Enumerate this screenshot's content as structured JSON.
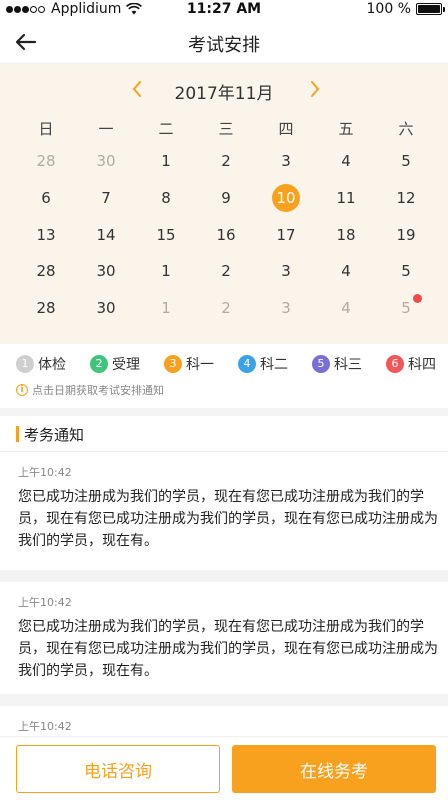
{
  "status_bar": {
    "carrier": "Applidium",
    "time": "11:27 AM",
    "battery": "100 %"
  },
  "nav": {
    "title": "考试安排"
  },
  "calendar": {
    "month": "2017年11月",
    "weekdays": [
      "日",
      "一",
      "二",
      "三",
      "四",
      "五",
      "六"
    ],
    "rows": [
      [
        {
          "d": "28",
          "muted": true
        },
        {
          "d": "30",
          "muted": true
        },
        {
          "d": "1"
        },
        {
          "d": "2"
        },
        {
          "d": "3"
        },
        {
          "d": "4"
        },
        {
          "d": "5"
        }
      ],
      [
        {
          "d": "6"
        },
        {
          "d": "7"
        },
        {
          "d": "8"
        },
        {
          "d": "9"
        },
        {
          "d": "10",
          "selected": true
        },
        {
          "d": "11"
        },
        {
          "d": "12"
        }
      ],
      [
        {
          "d": "13"
        },
        {
          "d": "14"
        },
        {
          "d": "15"
        },
        {
          "d": "16"
        },
        {
          "d": "17"
        },
        {
          "d": "18"
        },
        {
          "d": "19"
        }
      ],
      [
        {
          "d": "28"
        },
        {
          "d": "30"
        },
        {
          "d": "1"
        },
        {
          "d": "2"
        },
        {
          "d": "3"
        },
        {
          "d": "4"
        },
        {
          "d": "5"
        }
      ],
      [
        {
          "d": "28"
        },
        {
          "d": "30"
        },
        {
          "d": "1",
          "muted": true
        },
        {
          "d": "2",
          "muted": true
        },
        {
          "d": "3",
          "muted": true
        },
        {
          "d": "4",
          "muted": true
        },
        {
          "d": "5",
          "muted": true,
          "dot": true
        }
      ]
    ]
  },
  "legend": {
    "items": [
      {
        "num": "1",
        "label": "体检",
        "color": "#cfcfcf"
      },
      {
        "num": "2",
        "label": "受理",
        "color": "#3fc47c"
      },
      {
        "num": "3",
        "label": "科一",
        "color": "#f7a11e"
      },
      {
        "num": "4",
        "label": "科二",
        "color": "#3aa3e8"
      },
      {
        "num": "5",
        "label": "科三",
        "color": "#7a6fd6"
      },
      {
        "num": "6",
        "label": "科四",
        "color": "#f2575a"
      }
    ],
    "hint": "点击日期获取考试安排通知",
    "hint_icon": "i"
  },
  "notices": {
    "title": "考务通知",
    "items": [
      {
        "time": "上午10:42",
        "body": "您已成功注册成为我们的学员，现在有您已成功注册成为我们的学员，现在有您已成功注册成为我们的学员，现在有您已成功注册成为我们的学员，现在有。"
      },
      {
        "time": "上午10:42",
        "body": "您已成功注册成为我们的学员，现在有您已成功注册成为我们的学员，现在有您已成功注册成为我们的学员，现在有您已成功注册成为我们的学员，现在有。"
      },
      {
        "time": "上午10:42",
        "body": ""
      }
    ]
  },
  "bottom": {
    "phone_label": "电话咨询",
    "online_label": "在线务考"
  },
  "colors": {
    "accent": "#f7a11e",
    "calendar_bg": "#fbf4ea",
    "dot": "#f2494a"
  }
}
